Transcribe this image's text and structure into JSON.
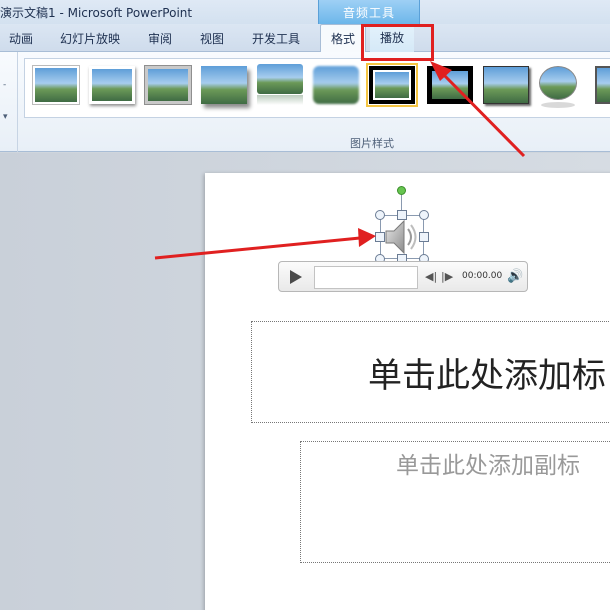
{
  "window": {
    "title": "演示文稿1 - Microsoft PowerPoint"
  },
  "context_tab_group": {
    "label": "音频工具"
  },
  "tabs": [
    {
      "label": "动画",
      "state": "normal"
    },
    {
      "label": "幻灯片放映",
      "state": "normal"
    },
    {
      "label": "审阅",
      "state": "normal"
    },
    {
      "label": "视图",
      "state": "normal"
    },
    {
      "label": "开发工具",
      "state": "normal"
    },
    {
      "label": "格式",
      "state": "active"
    },
    {
      "label": "播放",
      "state": "context"
    }
  ],
  "ribbon": {
    "group_label": "图片样式",
    "gallery_styles": [
      "simple-frame-white",
      "soft-shadow-white",
      "metal-frame",
      "drop-shadow",
      "reflected-rounded",
      "soft-edge-oval",
      "thick-black-frame",
      "double-frame-black",
      "black-shadow-rectangle",
      "oval-reflection",
      "metal-rounded"
    ]
  },
  "slide": {
    "title_placeholder": "单击此处添加标",
    "subtitle_placeholder": "单击此处添加副标"
  },
  "audio_player": {
    "time": "00:00.00",
    "rewind_glyph": "◀|",
    "forward_glyph": "|▶",
    "volume_glyph": "🔊"
  },
  "annotations": {
    "highlight_color": "#e02020"
  },
  "colors": {
    "accent": "#6cb6ea",
    "annotation": "#e02020"
  },
  "icons": {
    "play": "play-icon",
    "speaker": "speaker-icon",
    "volume": "volume-icon"
  }
}
